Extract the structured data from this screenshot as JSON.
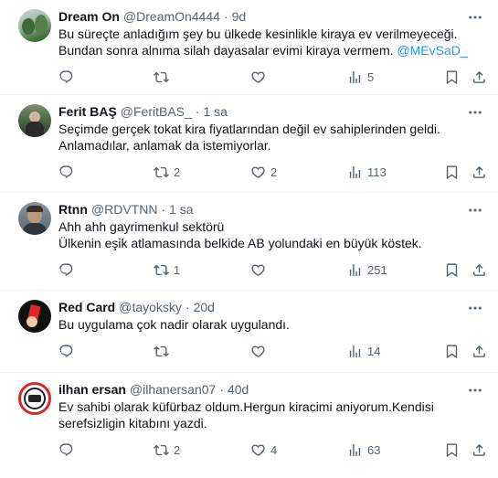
{
  "tweets": [
    {
      "name": "Dream On",
      "handle": "@DreamOn4444",
      "time": "9d",
      "text_lines": [
        "Bu süreçte anladığım şey bu ülkede kesinlikle kiraya ev verilmeyeceği.",
        "Bundan sonra alnıma silah dayasalar evimi kiraya vermem. "
      ],
      "mention": "@MEvSaD_",
      "replies": "",
      "retweets": "",
      "likes": "",
      "views": "5",
      "avatar_colors": [
        "#6b8f5a",
        "#c9d8e6"
      ]
    },
    {
      "name": "Ferit BAŞ",
      "handle": "@FeritBAS_",
      "time": "1 sa",
      "text_lines": [
        "Seçimde gerçek tokat kira fiyatlarından değil ev sahiplerinden geldi.",
        "Anlamadılar, anlamak da istemiyorlar."
      ],
      "mention": "",
      "replies": "",
      "retweets": "2",
      "likes": "2",
      "views": "113",
      "avatar_colors": [
        "#3f5a3a",
        "#8aa07a"
      ]
    },
    {
      "name": "Rtnn",
      "handle": "@RDVTNN",
      "time": "1 sa",
      "text_lines": [
        "Ahh ahh gayrimenkul sektörü",
        "Ülkenin eşik atlamasında belkide AB yolundaki en büyük köstek."
      ],
      "mention": "",
      "replies": "",
      "retweets": "1",
      "likes": "",
      "views": "251",
      "avatar_colors": [
        "#5a6470",
        "#b9a48c"
      ]
    },
    {
      "name": "Red Card",
      "handle": "@tayoksky",
      "time": "20d",
      "text_lines": [
        "Bu uygulama çok nadir olarak uygulandı."
      ],
      "mention": "",
      "replies": "",
      "retweets": "",
      "likes": "",
      "views": "14",
      "avatar_colors": [
        "#111111",
        "#e0262a"
      ]
    },
    {
      "name": "ilhan ersan",
      "handle": "@ilhanersan07",
      "time": "40d",
      "text_lines": [
        "Ev sahibi olarak küfürbaz oldum.Hergun kiracimi aniyorum.Kendisi",
        "serefsizligin kitabını yazdi."
      ],
      "mention": "",
      "replies": "",
      "retweets": "2",
      "likes": "4",
      "views": "63",
      "avatar_colors": [
        "#d42a2a",
        "#ffffff"
      ]
    }
  ],
  "separator": "·",
  "icons": [
    "reply-icon",
    "retweet-icon",
    "like-icon",
    "views-icon",
    "bookmark-icon",
    "share-icon",
    "more-icon"
  ]
}
